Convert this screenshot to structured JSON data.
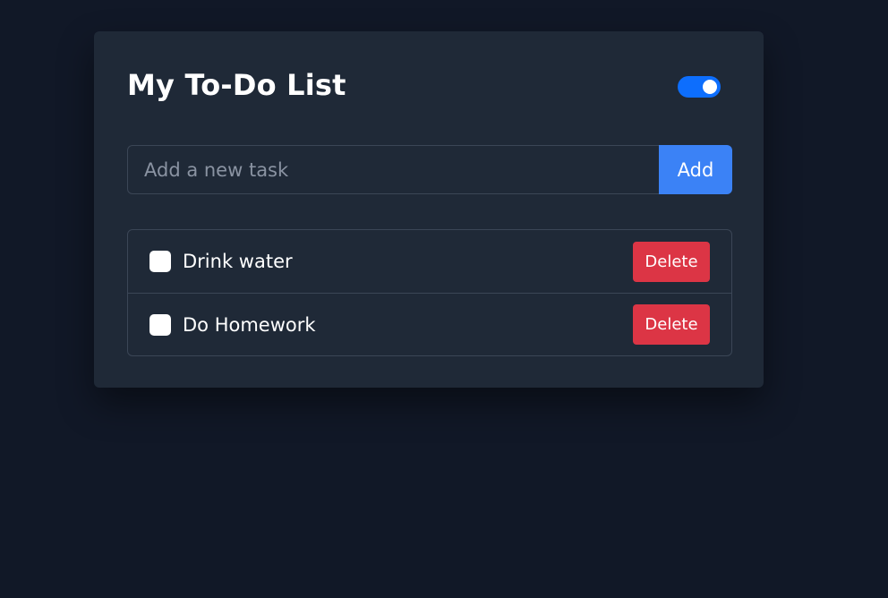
{
  "header": {
    "title": "My To-Do List"
  },
  "theme_toggle": {
    "state": "on",
    "color": "#0d6efd"
  },
  "add_task": {
    "placeholder": "Add a new task",
    "value": "",
    "button_label": "Add",
    "button_color": "#3b82f6"
  },
  "tasks": [
    {
      "label": "Drink water",
      "done": false,
      "delete_label": "Delete"
    },
    {
      "label": "Do Homework",
      "done": false,
      "delete_label": "Delete"
    }
  ],
  "colors": {
    "background": "#111827",
    "card": "#1f2937",
    "delete": "#dc3545"
  }
}
